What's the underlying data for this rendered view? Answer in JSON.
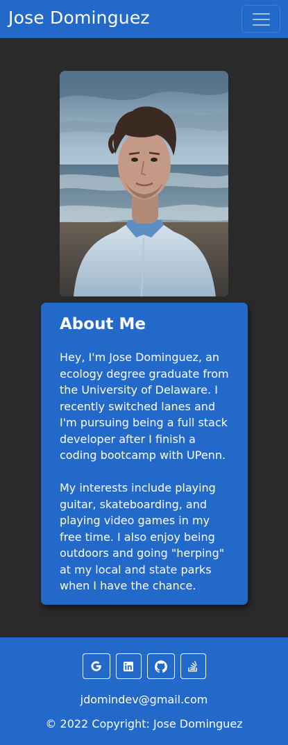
{
  "navbar": {
    "brand": "Jose Dominguez",
    "toggle_icon": "hamburger-menu-icon"
  },
  "profile": {
    "photo_alt": "Jose Dominguez"
  },
  "about": {
    "title": "About Me",
    "paragraph1": "Hey, I'm Jose Dominguez, an ecology degree graduate from the University of Delaware. I recently switched lanes and I'm pursuing being a full stack developer after I finish a coding bootcamp with UPenn.",
    "paragraph2": "My interests include playing guitar, skateboarding, and playing video games in my free time. I also enjoy being outdoors and going \"herping\" at my local and state parks when I have the chance."
  },
  "footer": {
    "social": [
      {
        "icon": "google-icon"
      },
      {
        "icon": "linkedin-icon"
      },
      {
        "icon": "github-icon"
      },
      {
        "icon": "stack-overflow-icon"
      }
    ],
    "email": "jdomindev@gmail.com",
    "copyright": "© 2022 Copyright: Jose Dominguez"
  },
  "colors": {
    "primary": "#2369c9",
    "background": "#2a2a2a"
  }
}
